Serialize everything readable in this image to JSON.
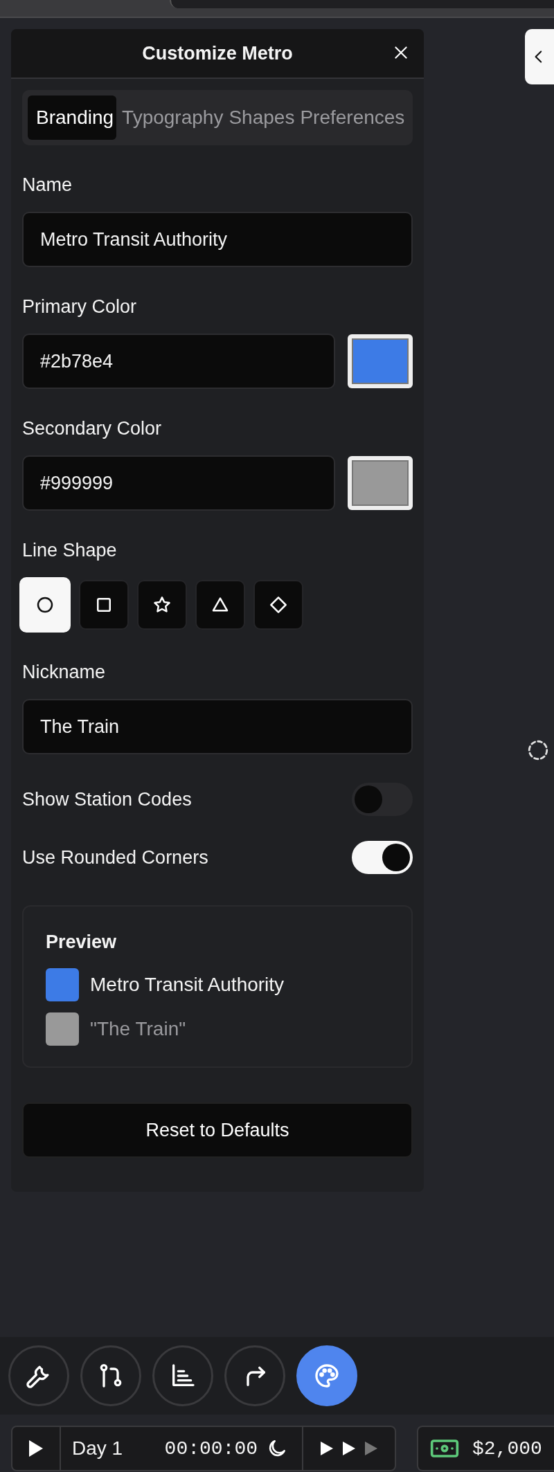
{
  "panel": {
    "title": "Customize Metro",
    "tabs": [
      {
        "label": "Branding",
        "selected": true
      },
      {
        "label": "Typography",
        "selected": false
      },
      {
        "label": "Shapes",
        "selected": false
      },
      {
        "label": "Preferences",
        "selected": false
      }
    ],
    "name": {
      "label": "Name",
      "value": "Metro Transit Authority"
    },
    "colors": [
      {
        "label": "Primary Color",
        "value": "#2b78e4",
        "color": "#3d7be6"
      },
      {
        "label": "Secondary Color",
        "value": "#999999",
        "color": "#999999"
      }
    ],
    "line_shape": {
      "label": "Line Shape",
      "options": [
        {
          "kind": "circle",
          "selected": true
        },
        {
          "kind": "square",
          "selected": false
        },
        {
          "kind": "star",
          "selected": false
        },
        {
          "kind": "triangle",
          "selected": false
        },
        {
          "kind": "diamond",
          "selected": false
        }
      ]
    },
    "nickname": {
      "label": "Nickname",
      "value": "The Train"
    },
    "toggles": [
      {
        "label": "Show Station Codes",
        "on": false
      },
      {
        "label": "Use Rounded Corners",
        "on": true
      }
    ],
    "preview": {
      "title": "Preview",
      "items": [
        {
          "text": "Metro Transit Authority",
          "color": "#3d7be6",
          "muted": false
        },
        {
          "text": "\"The Train\"",
          "color": "#999999",
          "muted": true
        }
      ]
    },
    "reset_button": "Reset to Defaults"
  },
  "toolbar": [
    {
      "kind": "wrench",
      "selected": false
    },
    {
      "kind": "branch",
      "selected": false
    },
    {
      "kind": "chart",
      "selected": false
    },
    {
      "kind": "redirect",
      "selected": false
    },
    {
      "kind": "palette",
      "selected": true
    }
  ],
  "status_bar": {
    "day": "Day 1",
    "time": "00:00:00",
    "speeds": [
      {
        "active": true
      },
      {
        "active": true
      },
      {
        "active": false
      }
    ],
    "money": "$2,000"
  }
}
